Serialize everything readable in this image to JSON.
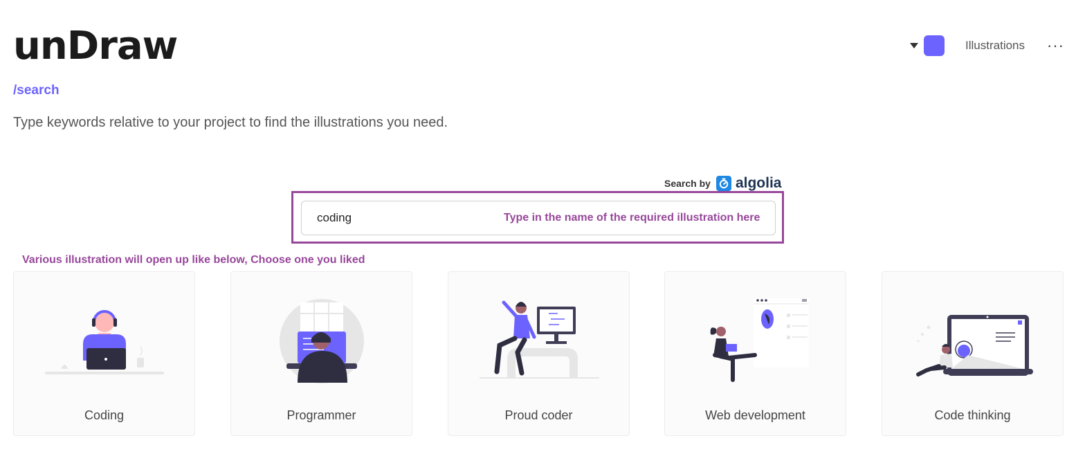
{
  "app": {
    "logo": "unDraw",
    "route": "/search"
  },
  "header": {
    "accent_color": "#6c63ff",
    "nav_label": "Illustrations",
    "more_label": "···"
  },
  "intro": {
    "description": "Type keywords relative to your project to find the illustrations you need."
  },
  "search": {
    "powered_by_label": "Search by",
    "provider": "algolia",
    "value": "coding",
    "annotation": "Type in the name of the required illustration here"
  },
  "results": {
    "annotation": "Various illustration will open up like below, Choose one you liked",
    "items": [
      {
        "label": "Coding",
        "icon": "coding-illustration"
      },
      {
        "label": "Programmer",
        "icon": "programmer-illustration"
      },
      {
        "label": "Proud coder",
        "icon": "proud-coder-illustration"
      },
      {
        "label": "Web development",
        "icon": "web-development-illustration"
      },
      {
        "label": "Code thinking",
        "icon": "code-thinking-illustration"
      }
    ]
  },
  "colors": {
    "accent": "#6c63ff",
    "annotation": "#97479a",
    "dark": "#2f2e41"
  }
}
